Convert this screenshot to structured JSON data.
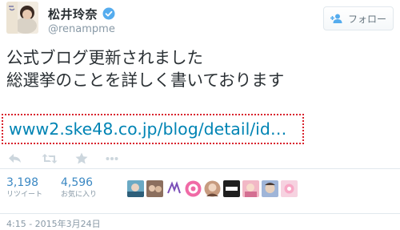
{
  "user": {
    "display_name": "松井玲奈",
    "handle": "@renampme",
    "avatar_icon": "profile-photo"
  },
  "follow_button": {
    "label": "フォロー",
    "icon": "follow-user-icon"
  },
  "tweet": {
    "lines": [
      "公式ブログ更新されました",
      "総選挙のことを詳しく書いております"
    ],
    "link_text": "www2.ske48.co.jp/blog/detail/id…",
    "link_color": "#0084b4"
  },
  "actions": [
    "reply-icon",
    "retweet-icon",
    "favorite-icon",
    "more-icon"
  ],
  "stats": {
    "retweets": {
      "count": "3,198",
      "label": "リツイート"
    },
    "favorites": {
      "count": "4,596",
      "label": "お気に入り"
    }
  },
  "timestamp": "4:15 - 2015年3月24日"
}
